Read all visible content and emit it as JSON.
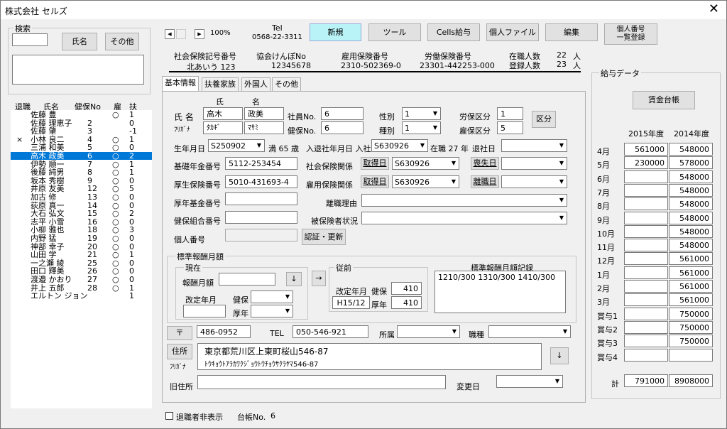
{
  "window": {
    "title": "株式会社 セルズ",
    "close": "✕"
  },
  "search": {
    "group_title": "検索",
    "name_button": "氏名",
    "other_button": "その他",
    "input_value": ""
  },
  "employee_list": {
    "headers": [
      "退職",
      "氏名",
      "健保No",
      "雇",
      "扶"
    ],
    "rows": [
      {
        "ret": "",
        "name": "佐藤 豊",
        "no": "",
        "emp": "○",
        "dep": "1"
      },
      {
        "ret": "",
        "name": "佐藤 理恵子",
        "no": "2",
        "emp": "",
        "dep": "0"
      },
      {
        "ret": "",
        "name": "佐藤 肇",
        "no": "3",
        "emp": "",
        "dep": "-1"
      },
      {
        "ret": "×",
        "name": "小林 良二",
        "no": "4",
        "emp": "○",
        "dep": "1"
      },
      {
        "ret": "",
        "name": "三浦 和美",
        "no": "5",
        "emp": "○",
        "dep": "0"
      },
      {
        "ret": "",
        "name": "高木 政美",
        "no": "6",
        "emp": "○",
        "dep": "2"
      },
      {
        "ret": "",
        "name": "伊勢 順一",
        "no": "7",
        "emp": "○",
        "dep": "1"
      },
      {
        "ret": "",
        "name": "後藤 純男",
        "no": "8",
        "emp": "○",
        "dep": "1"
      },
      {
        "ret": "",
        "name": "坂本 秀樹",
        "no": "9",
        "emp": "○",
        "dep": "0"
      },
      {
        "ret": "",
        "name": "井原 友美",
        "no": "12",
        "emp": "○",
        "dep": "5"
      },
      {
        "ret": "",
        "name": "加古 修",
        "no": "13",
        "emp": "○",
        "dep": "0"
      },
      {
        "ret": "",
        "name": "荻原 真一",
        "no": "14",
        "emp": "○",
        "dep": "0"
      },
      {
        "ret": "",
        "name": "大石 弘文",
        "no": "15",
        "emp": "○",
        "dep": "2"
      },
      {
        "ret": "",
        "name": "志平 小雪",
        "no": "16",
        "emp": "○",
        "dep": "0"
      },
      {
        "ret": "",
        "name": "小柳 雅也",
        "no": "18",
        "emp": "○",
        "dep": "3"
      },
      {
        "ret": "",
        "name": "内野 猛",
        "no": "19",
        "emp": "○",
        "dep": "0"
      },
      {
        "ret": "",
        "name": "神部 幸子",
        "no": "20",
        "emp": "○",
        "dep": "0"
      },
      {
        "ret": "",
        "name": "山田 学",
        "no": "21",
        "emp": "○",
        "dep": "1"
      },
      {
        "ret": "",
        "name": "一之瀬 綾",
        "no": "25",
        "emp": "○",
        "dep": "0"
      },
      {
        "ret": "",
        "name": "田口 輝美",
        "no": "26",
        "emp": "○",
        "dep": "0"
      },
      {
        "ret": "",
        "name": "渡邉 かおり",
        "no": "27",
        "emp": "○",
        "dep": "0"
      },
      {
        "ret": "",
        "name": "井上 五郎",
        "no": "28",
        "emp": "○",
        "dep": "1"
      },
      {
        "ret": "",
        "name": "エルトン ジョン",
        "no": "",
        "emp": "",
        "dep": "1"
      }
    ],
    "selected_index": 5
  },
  "toolbar": {
    "zoom": "100%",
    "tel_label": "Tel",
    "tel_value": "0568-22-3311",
    "new_button": "新規",
    "tools_button": "ツール",
    "cells_button": "Cells給与",
    "personal_file_button": "個人ファイル",
    "edit_button": "編集",
    "mynumber_button_l1": "個人番号",
    "mynumber_button_l2": "一覧登録"
  },
  "company": {
    "social_label": "社会保険記号番号",
    "social_value": "北あいう 123",
    "kyokai_label": "協会けんぽNo",
    "kyokai_value": "12345678",
    "koyo_label": "雇用保険番号",
    "koyo_value": "2310-502369-0",
    "rodo_label": "労働保険番号",
    "rodo_value": "23301-442253-000",
    "active_label": "在職人数",
    "active_value": "22",
    "reg_label": "登録人数",
    "reg_value": "23",
    "unit": "人"
  },
  "tabs": [
    "基本情報",
    "扶養家族",
    "外国人",
    "その他"
  ],
  "basic": {
    "sei_label": "氏",
    "mei_label": "名",
    "name_label": "氏 名",
    "kana_label": "ﾌﾘｶﾞﾅ",
    "sei": "高木",
    "mei": "政美",
    "sei_kana": "ﾀｶｷﾞ",
    "mei_kana": "ﾏｻﾐ",
    "shain_label": "社員No.",
    "shain_value": "6",
    "kenpo_label": "健保No.",
    "kenpo_value": "6",
    "sex_label": "性別",
    "sex_value": "1",
    "kind_label": "種別",
    "kind_value": "1",
    "rodo_kubun_label": "労保区分",
    "rodo_kubun_value": "1",
    "koyo_kubun_label": "雇保区分",
    "koyo_kubun_value": "5",
    "kubun_button": "区分",
    "birth_label": "生年月日",
    "birth_value": "S250902",
    "age_text": "満 65 歳",
    "join_label": "入退社年月日 入社",
    "join_value": "S630926",
    "tenure_text": "在職 27 年",
    "leave_label": "退社日",
    "leave_value": "",
    "pension_label": "基礎年金番号",
    "pension_value": "5112-253454",
    "social_rel_label": "社会保険関係",
    "acquire_label": "取得日",
    "social_acquire_value": "S630926",
    "lost_label": "喪失日",
    "social_lost_value": "",
    "health_label": "厚生保険番号",
    "health_value": "5010-431693-4",
    "emp_rel_label": "雇用保険関係",
    "emp_acquire_value": "S630926",
    "leave_date_label": "離職日",
    "emp_leave_value": "",
    "kosei_fund_label": "厚年基金番号",
    "kosei_fund_value": "",
    "leave_reason_label": "離職理由",
    "leave_reason_value": "",
    "union_label": "健保組合番号",
    "union_value": "",
    "insured_status_label": "被保険者状況",
    "insured_status_value": "",
    "mynumber_label": "個人番号",
    "mynumber_value": "",
    "auth_button": "認証・更新"
  },
  "standard": {
    "group_title": "標準報酬月額",
    "current_title": "現在",
    "monthly_label": "報酬月額",
    "monthly_value": "",
    "down_btn": "↓",
    "revise_label": "改定年月",
    "revise_value": "",
    "kenpo_label": "健保",
    "kenpo_value": "",
    "kosei_label": "厚年",
    "kosei_value": "",
    "arrow_btn": "→",
    "prev_title": "従前",
    "prev_revise_label": "改定年月",
    "prev_kenpo_label": "健保",
    "prev_kenpo_value": "410",
    "prev_revise_value": "H15/12",
    "prev_kosei_label": "厚年",
    "prev_kosei_value": "410",
    "record_title": "標準報酬月額記録",
    "record_value": "1210/300 1310/300 1410/300"
  },
  "address": {
    "zip_button": "〒",
    "zip_value": "486-0952",
    "tel_label": "TEL",
    "tel_value": "050-546-921",
    "dept_label": "所属",
    "dept_value": "",
    "job_label": "職種",
    "job_value": "",
    "addr_button": "住所",
    "kana_label": "ﾌﾘｶﾞﾅ",
    "addr_value": "東京都荒川区上東町桜山546-87",
    "addr_kana": "ﾄｳｷｮｳﾄｱﾗｶﾜｸｼﾞｮｳﾄｳﾁｮｳｻｸﾗﾔﾏ546-87",
    "down_btn": "↓",
    "old_label": "旧住所",
    "old_value": "",
    "change_label": "変更日",
    "change_value": ""
  },
  "footer": {
    "hide_retired_label": "退職者非表示",
    "ledger_label": "台帳No.",
    "ledger_value": "6"
  },
  "salary": {
    "group_title": "給与データ",
    "ledger_button": "賃金台帳",
    "col1": "2015年度",
    "col2": "2014年度",
    "rows": [
      {
        "label": "4月",
        "a": "561000",
        "b": "548000"
      },
      {
        "label": "5月",
        "a": "230000",
        "b": "578000"
      },
      {
        "label": "6月",
        "a": "",
        "b": "548000"
      },
      {
        "label": "7月",
        "a": "",
        "b": "548000"
      },
      {
        "label": "8月",
        "a": "",
        "b": "548000"
      },
      {
        "label": "9月",
        "a": "",
        "b": "548000"
      },
      {
        "label": "10月",
        "a": "",
        "b": "548000"
      },
      {
        "label": "11月",
        "a": "",
        "b": "548000"
      },
      {
        "label": "12月",
        "a": "",
        "b": "561000"
      },
      {
        "label": "1月",
        "a": "",
        "b": "561000"
      },
      {
        "label": "2月",
        "a": "",
        "b": "561000"
      },
      {
        "label": "3月",
        "a": "",
        "b": "561000"
      },
      {
        "label": "賞与1",
        "a": "",
        "b": "750000"
      },
      {
        "label": "賞与2",
        "a": "",
        "b": "750000"
      },
      {
        "label": "賞与3",
        "a": "",
        "b": "750000"
      },
      {
        "label": "賞与4",
        "a": "",
        "b": ""
      }
    ],
    "total_label": "計",
    "total_a": "791000",
    "total_b": "8908000"
  }
}
